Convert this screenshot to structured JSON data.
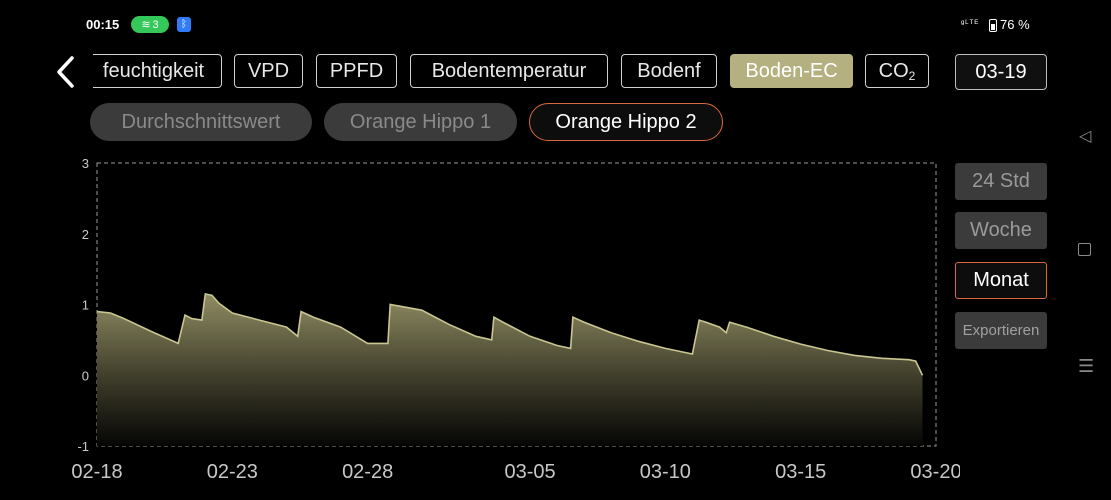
{
  "status_bar": {
    "time": "00:15",
    "wifi_count": "3",
    "network": "ᵍᴸᵀᴱ",
    "battery": "76 %"
  },
  "metric_tabs": [
    {
      "label": "feuchtigkeit",
      "active": false
    },
    {
      "label": "VPD",
      "active": false
    },
    {
      "label": "PPFD",
      "active": false
    },
    {
      "label": "Bodentemperatur",
      "active": false
    },
    {
      "label": "Bodenf",
      "active": false
    },
    {
      "label": "Boden-EC",
      "active": true
    },
    {
      "label": "CO",
      "subscript": "2",
      "active": false
    }
  ],
  "date_button": {
    "label": "03-19"
  },
  "device_chips": [
    {
      "label": "Durchschnittswert",
      "active": false
    },
    {
      "label": "Orange Hippo 1",
      "active": false
    },
    {
      "label": "Orange Hippo 2",
      "active": true
    }
  ],
  "range_buttons": [
    {
      "label": "24 Std",
      "active": false
    },
    {
      "label": "Woche",
      "active": false
    },
    {
      "label": "Monat",
      "active": true
    }
  ],
  "export_button": {
    "label": "Exportieren"
  },
  "colors": {
    "accent": "#b5b07f",
    "active_border": "#d9683b",
    "series_line": "#c9c690",
    "background": "#000000"
  },
  "icons": {
    "back": "chevron-left-icon",
    "nav_back": "triangle-left-icon",
    "nav_home": "square-icon",
    "nav_menu": "menu-lines-icon"
  },
  "chart_data": {
    "type": "area",
    "title": "",
    "xlabel": "",
    "ylabel": "",
    "ylim": [
      -1,
      3
    ],
    "yticks": [
      -1,
      0,
      1,
      2,
      3
    ],
    "xlim": [
      "02-18",
      "03-20"
    ],
    "xticks": [
      "02-18",
      "02-23",
      "02-28",
      "03-05",
      "03-10",
      "03-15",
      "03-20"
    ],
    "grid": false,
    "series": [
      {
        "points": [
          [
            "02-18",
            0.9
          ],
          [
            "02-18 12:00",
            0.88
          ],
          [
            "02-19",
            0.8
          ],
          [
            "02-20",
            0.62
          ],
          [
            "02-21",
            0.45
          ],
          [
            "02-21 06:00",
            0.85
          ],
          [
            "02-21 12:00",
            0.8
          ],
          [
            "02-21 21:00",
            0.78
          ],
          [
            "02-22",
            1.15
          ],
          [
            "02-22 06:00",
            1.13
          ],
          [
            "02-22 12:00",
            1.02
          ],
          [
            "02-23",
            0.88
          ],
          [
            "02-24",
            0.78
          ],
          [
            "02-25",
            0.68
          ],
          [
            "02-25 10:00",
            0.55
          ],
          [
            "02-25 13:00",
            0.9
          ],
          [
            "02-26",
            0.82
          ],
          [
            "02-27",
            0.68
          ],
          [
            "02-28",
            0.45
          ],
          [
            "02-28 18:00",
            0.45
          ],
          [
            "02-28 20:00",
            1.0
          ],
          [
            "03-01",
            0.92
          ],
          [
            "03-02",
            0.72
          ],
          [
            "03-03",
            0.55
          ],
          [
            "03-03 14:00",
            0.5
          ],
          [
            "03-03 16:00",
            0.82
          ],
          [
            "03-04",
            0.75
          ],
          [
            "03-05",
            0.55
          ],
          [
            "03-06",
            0.42
          ],
          [
            "03-06 12:00",
            0.38
          ],
          [
            "03-06 14:00",
            0.82
          ],
          [
            "03-07",
            0.75
          ],
          [
            "03-08",
            0.6
          ],
          [
            "03-09",
            0.48
          ],
          [
            "03-10",
            0.38
          ],
          [
            "03-10 18:00",
            0.32
          ],
          [
            "03-11",
            0.3
          ],
          [
            "03-11 06:00",
            0.78
          ],
          [
            "03-11 12:00",
            0.75
          ],
          [
            "03-12",
            0.68
          ],
          [
            "03-12 06:00",
            0.6
          ],
          [
            "03-12 09:00",
            0.75
          ],
          [
            "03-13",
            0.68
          ],
          [
            "03-14",
            0.55
          ],
          [
            "03-15",
            0.44
          ],
          [
            "03-16",
            0.35
          ],
          [
            "03-17",
            0.28
          ],
          [
            "03-18",
            0.24
          ],
          [
            "03-19",
            0.22
          ],
          [
            "03-19 06:00",
            0.2
          ],
          [
            "03-19 12:00",
            0.0
          ]
        ]
      }
    ]
  }
}
